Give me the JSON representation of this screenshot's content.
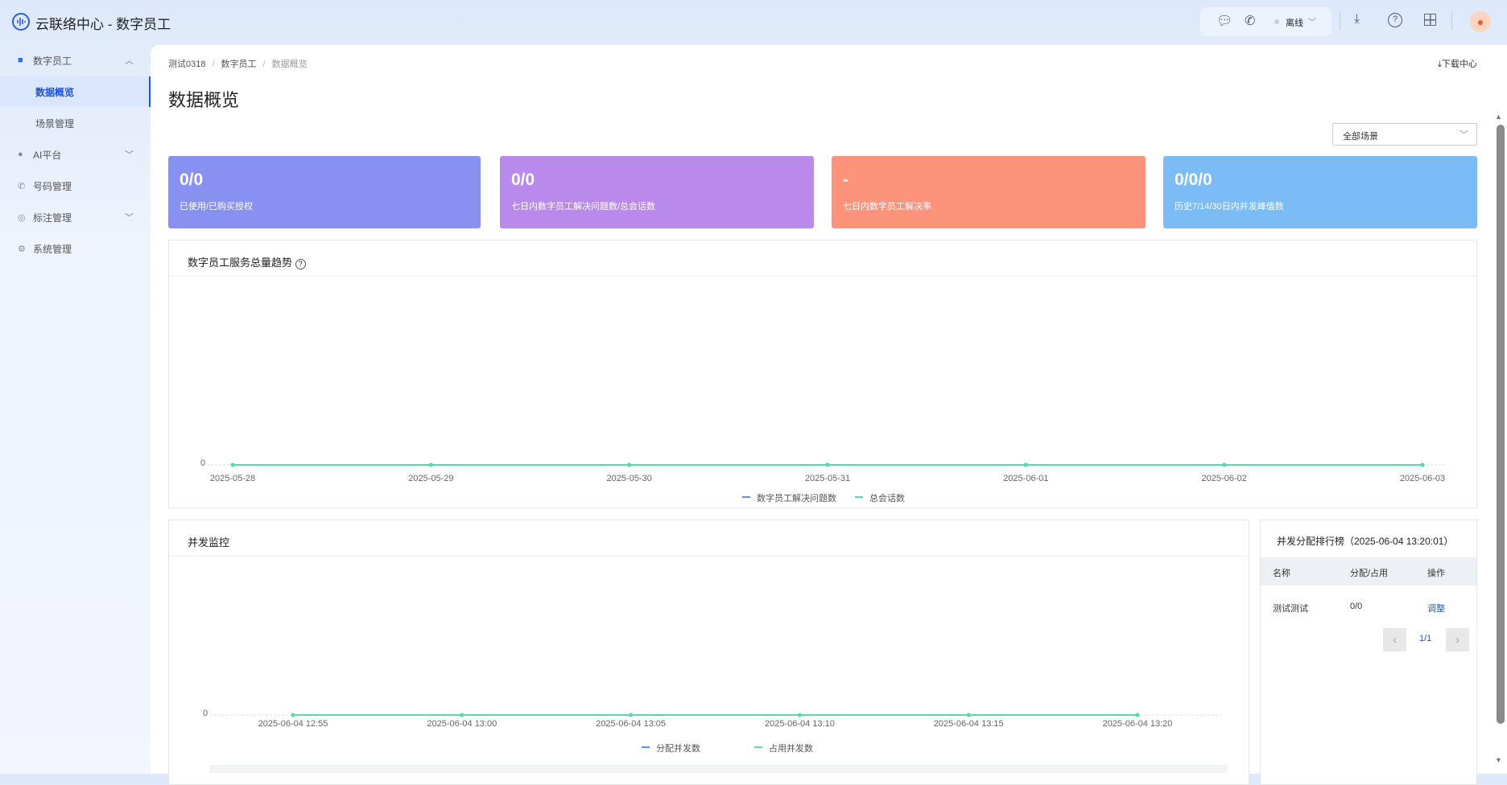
{
  "app": {
    "title": "云联络中心 - 数字员工",
    "status": "离线"
  },
  "sidebar": {
    "items": [
      {
        "label": "数字员工",
        "icon": "robot-icon"
      },
      {
        "label": "数据概览",
        "active": true
      },
      {
        "label": "场景管理"
      },
      {
        "label": "AI平台",
        "icon": "ai-icon"
      },
      {
        "label": "号码管理",
        "icon": "phone-icon"
      },
      {
        "label": "标注管理",
        "icon": "tag-icon"
      },
      {
        "label": "系统管理",
        "icon": "gear-icon"
      }
    ]
  },
  "breadcrumb": [
    "测试0318",
    "数字员工",
    "数据概览"
  ],
  "page_title": "数据概览",
  "download_center": "下载中心",
  "scene_select": "全部场景",
  "cards": [
    {
      "value": "0/0",
      "label": "已使用/已购买授权",
      "color": "#8891f0"
    },
    {
      "value": "0/0",
      "label": "七日内数字员工解决问题数/总会话数",
      "color": "#b98aec"
    },
    {
      "value": "-",
      "label": "七日内数字员工解决率",
      "color": "#fe937b"
    },
    {
      "value": "0/0/0",
      "label": "历史7/14/30日内并发峰值数",
      "color": "#7bbcf7"
    }
  ],
  "chart_data": [
    {
      "type": "line",
      "title": "数字员工服务总量趋势",
      "categories": [
        "2025-05-28",
        "2025-05-29",
        "2025-05-30",
        "2025-05-31",
        "2025-06-01",
        "2025-06-02",
        "2025-06-03"
      ],
      "series": [
        {
          "name": "数字员工解决问题数",
          "color": "#5b8ff9",
          "values": [
            0,
            0,
            0,
            0,
            0,
            0,
            0
          ]
        },
        {
          "name": "总会话数",
          "color": "#5ad8a6",
          "values": [
            0,
            0,
            0,
            0,
            0,
            0,
            0
          ]
        }
      ],
      "yticks": [
        "0"
      ]
    },
    {
      "type": "line",
      "title": "并发监控",
      "categories": [
        "2025-06-04 12:55",
        "2025-06-04 13:00",
        "2025-06-04 13:05",
        "2025-06-04 13:10",
        "2025-06-04 13:15",
        "2025-06-04 13:20"
      ],
      "series": [
        {
          "name": "分配并发数",
          "color": "#5b8ff9",
          "values": [
            0,
            0,
            0,
            0,
            0,
            0
          ]
        },
        {
          "name": "占用并发数",
          "color": "#5ad8a6",
          "values": [
            0,
            0,
            0,
            0,
            0,
            0
          ]
        }
      ],
      "yticks": [
        "0"
      ]
    }
  ],
  "ranking": {
    "title": "并发分配排行榜（2025-06-04 13:20:01）",
    "headers": [
      "名称",
      "分配/占用",
      "操作"
    ],
    "rows": [
      {
        "name": "测试测试",
        "value": "0/0",
        "action": "调整"
      }
    ],
    "page": "1/1"
  }
}
